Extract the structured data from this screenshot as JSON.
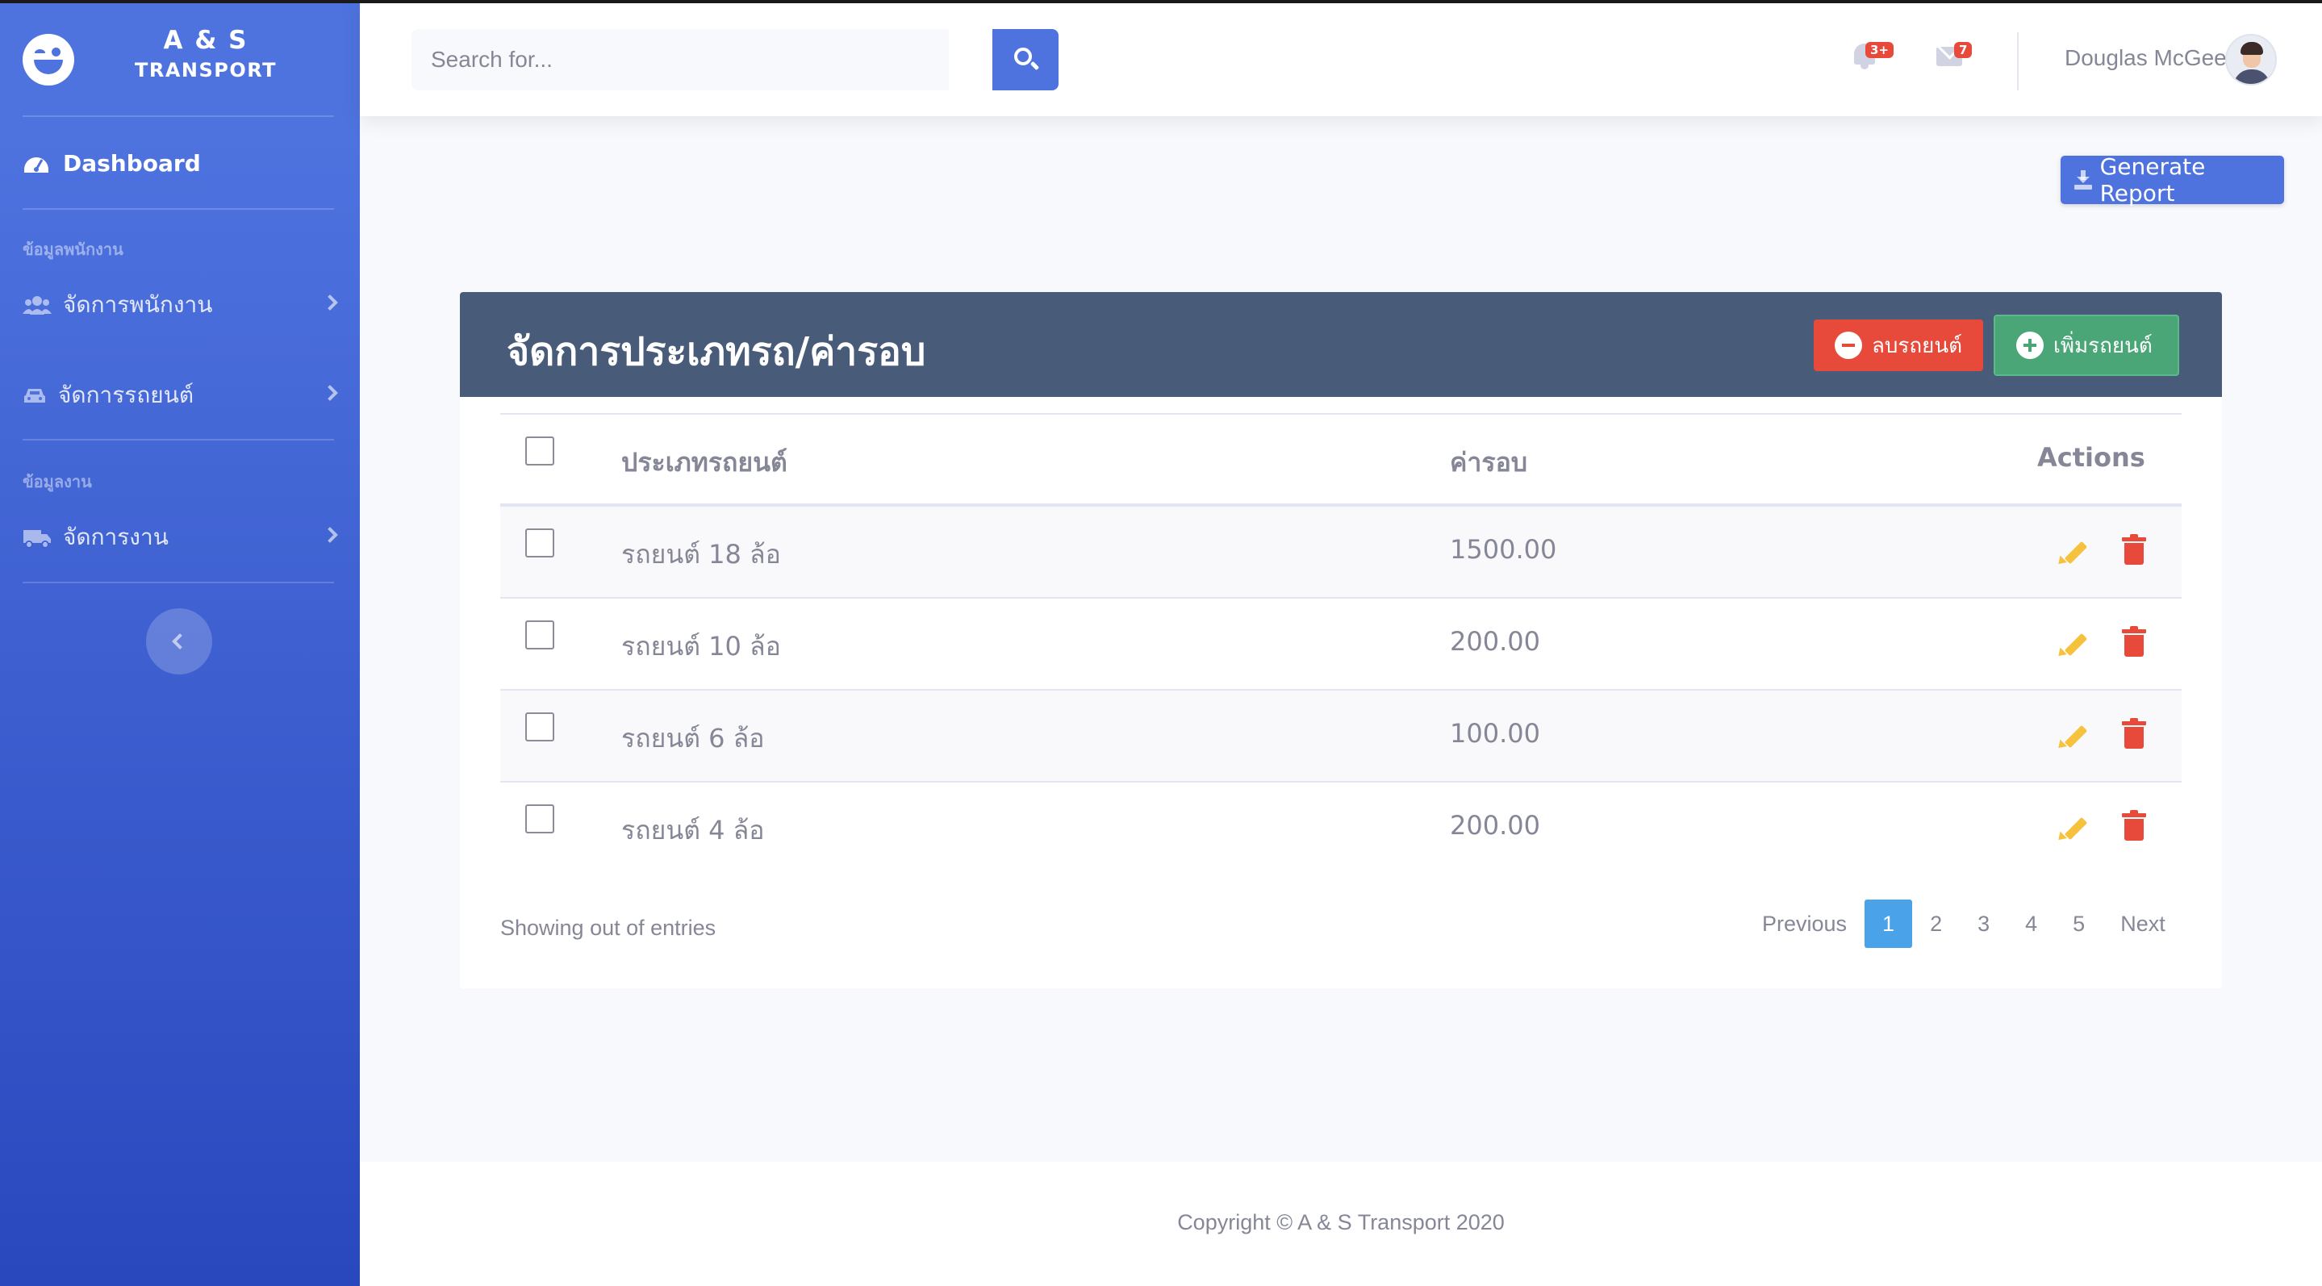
{
  "brand": {
    "line1": "A & S",
    "line2": "TRANSPORT"
  },
  "sidebar": {
    "dashboard_label": "Dashboard",
    "heading_employee": "ข้อมูลพนักงาน",
    "items": [
      {
        "label": "จัดการพนักงาน"
      },
      {
        "label": "จัดการรถยนต์"
      }
    ],
    "heading_work": "ข้อมูลงาน",
    "work_item": "จัดการงาน"
  },
  "topbar": {
    "search_placeholder": "Search for...",
    "alerts_count": "3+",
    "messages_count": "7",
    "user_name": "Douglas McGee"
  },
  "actions": {
    "generate_report": "Generate Report"
  },
  "card": {
    "title": "จัดการประเภทรถ/ค่ารอบ",
    "delete_label": "ลบรถยนต์",
    "add_label": "เพิ่มรถยนต์"
  },
  "table": {
    "headers": {
      "type": "ประเภทรถยนต์",
      "price": "ค่ารอบ",
      "actions": "Actions"
    },
    "rows": [
      {
        "type": "รถยนต์ 18 ล้อ",
        "price": "1500.00"
      },
      {
        "type": "รถยนต์ 10 ล้อ",
        "price": "200.00"
      },
      {
        "type": "รถยนต์ 6 ล้อ",
        "price": "100.00"
      },
      {
        "type": "รถยนต์ 4 ล้อ",
        "price": "200.00"
      }
    ]
  },
  "pagination": {
    "info": "Showing out of entries",
    "previous": "Previous",
    "pages": [
      "1",
      "2",
      "3",
      "4",
      "5"
    ],
    "active_page": "1",
    "next": "Next"
  },
  "footer": {
    "copyright": "Copyright © A & S Transport 2020"
  },
  "colors": {
    "primary": "#4e73df",
    "danger": "#e74a3b",
    "success": "#4aa677",
    "warning": "#f6c23e",
    "card_header": "#485b78",
    "pagination_active": "#4aa3e8"
  }
}
